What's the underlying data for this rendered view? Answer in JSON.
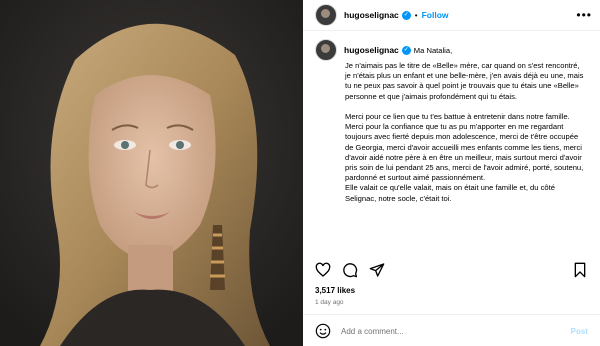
{
  "colors": {
    "accent": "#0095f6",
    "muted": "#737373",
    "post_disabled": "#b2dffc"
  },
  "header": {
    "username": "hugoselignac",
    "separator": "•",
    "follow_label": "Follow",
    "more_icon": "more-horizontal-icon"
  },
  "caption": {
    "username": "hugoselignac",
    "greeting": "Ma Natalia,",
    "text": "Je n'aimais pas le titre de «Belle» mère, car quand on s'est rencontré, je n'étais plus un enfant et une belle-mère, j'en avais déjà eu une, mais tu ne peux pas savoir à quel point je trouvais que tu étais une «Belle» personne et que j'aimais profondément qui tu étais.\n\nMerci pour ce lien que tu t'es battue à entretenir dans notre famille.\nMerci pour la confiance que tu as pu m'apporter en me regardant toujours avec fierté depuis mon adolescence, merci de t'être occupée de Georgia, merci d'avoir accueilli mes enfants comme les tiens, merci d'avoir aidé notre père à en être un meilleur, mais surtout merci d'avoir pris soin de lui pendant 25 ans, merci de l'avoir admiré, porté, soutenu, pardonné et surtout aimé passionnément.\nElle valait ce qu'elle valait, mais on était une famille et, du côté Selignac, notre socle, c'était toi."
  },
  "actions": [
    "heart-icon",
    "comment-icon",
    "share-icon",
    "bookmark-icon"
  ],
  "likes": "3,517 likes",
  "time_ago": "1 day ago",
  "comment_box": {
    "placeholder": "Add a comment...",
    "post_label": "Post"
  }
}
